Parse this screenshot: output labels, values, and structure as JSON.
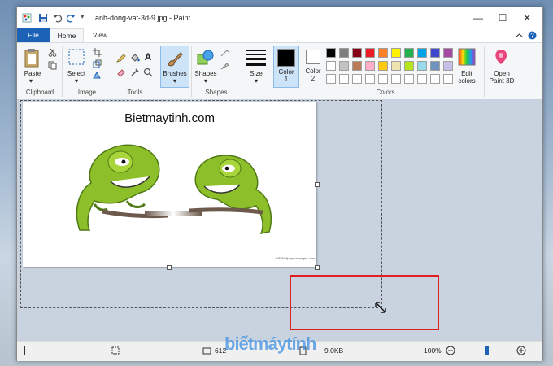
{
  "window": {
    "title": "anh-dong-vat-3d-9.jpg - Paint",
    "minimize": "—",
    "maximize": "☐",
    "close": "✕",
    "quick_access_dropdown": "▾"
  },
  "tabs": {
    "file": "File",
    "home": "Home",
    "view": "View"
  },
  "ribbon": {
    "clipboard": {
      "paste": "Paste",
      "label": "Clipboard"
    },
    "image": {
      "select": "Select",
      "label": "Image"
    },
    "tools": {
      "label": "Tools",
      "text_tool": "A"
    },
    "brushes": {
      "label": "Brushes"
    },
    "shapes": {
      "label": "Shapes",
      "group_label": "Shapes"
    },
    "size": {
      "label": "Size"
    },
    "color1": {
      "label": "Color",
      "sub": "1"
    },
    "color2": {
      "label": "Color",
      "sub": "2"
    },
    "colors_label": "Colors",
    "edit_colors": {
      "line1": "Edit",
      "line2": "colors"
    },
    "paint3d": {
      "line1": "Open",
      "line2": "Paint 3D"
    }
  },
  "palette": {
    "row1": [
      "#000000",
      "#7f7f7f",
      "#880015",
      "#ed1c24",
      "#ff7f27",
      "#fff200",
      "#22b14c",
      "#00a2e8",
      "#3f48cc",
      "#a349a4"
    ],
    "row2": [
      "#ffffff",
      "#c3c3c3",
      "#b97a57",
      "#ffaec9",
      "#ffc90e",
      "#efe4b0",
      "#b5e61d",
      "#99d9ea",
      "#7092be",
      "#c8bfe7"
    ],
    "row3": [
      "#ffffff",
      "#ffffff",
      "#ffffff",
      "#ffffff",
      "#ffffff",
      "#ffffff",
      "#ffffff",
      "#ffffff",
      "#ffffff",
      "#ffffff"
    ]
  },
  "canvas": {
    "heading": "Bietmaytinh.com",
    "watermark_small": "HDWallpapersImages.com"
  },
  "status": {
    "dimensions": "612",
    "size": "9.0KB",
    "zoom": "100%",
    "zoom_level": 0.5
  },
  "watermark": "biếtmáytính"
}
